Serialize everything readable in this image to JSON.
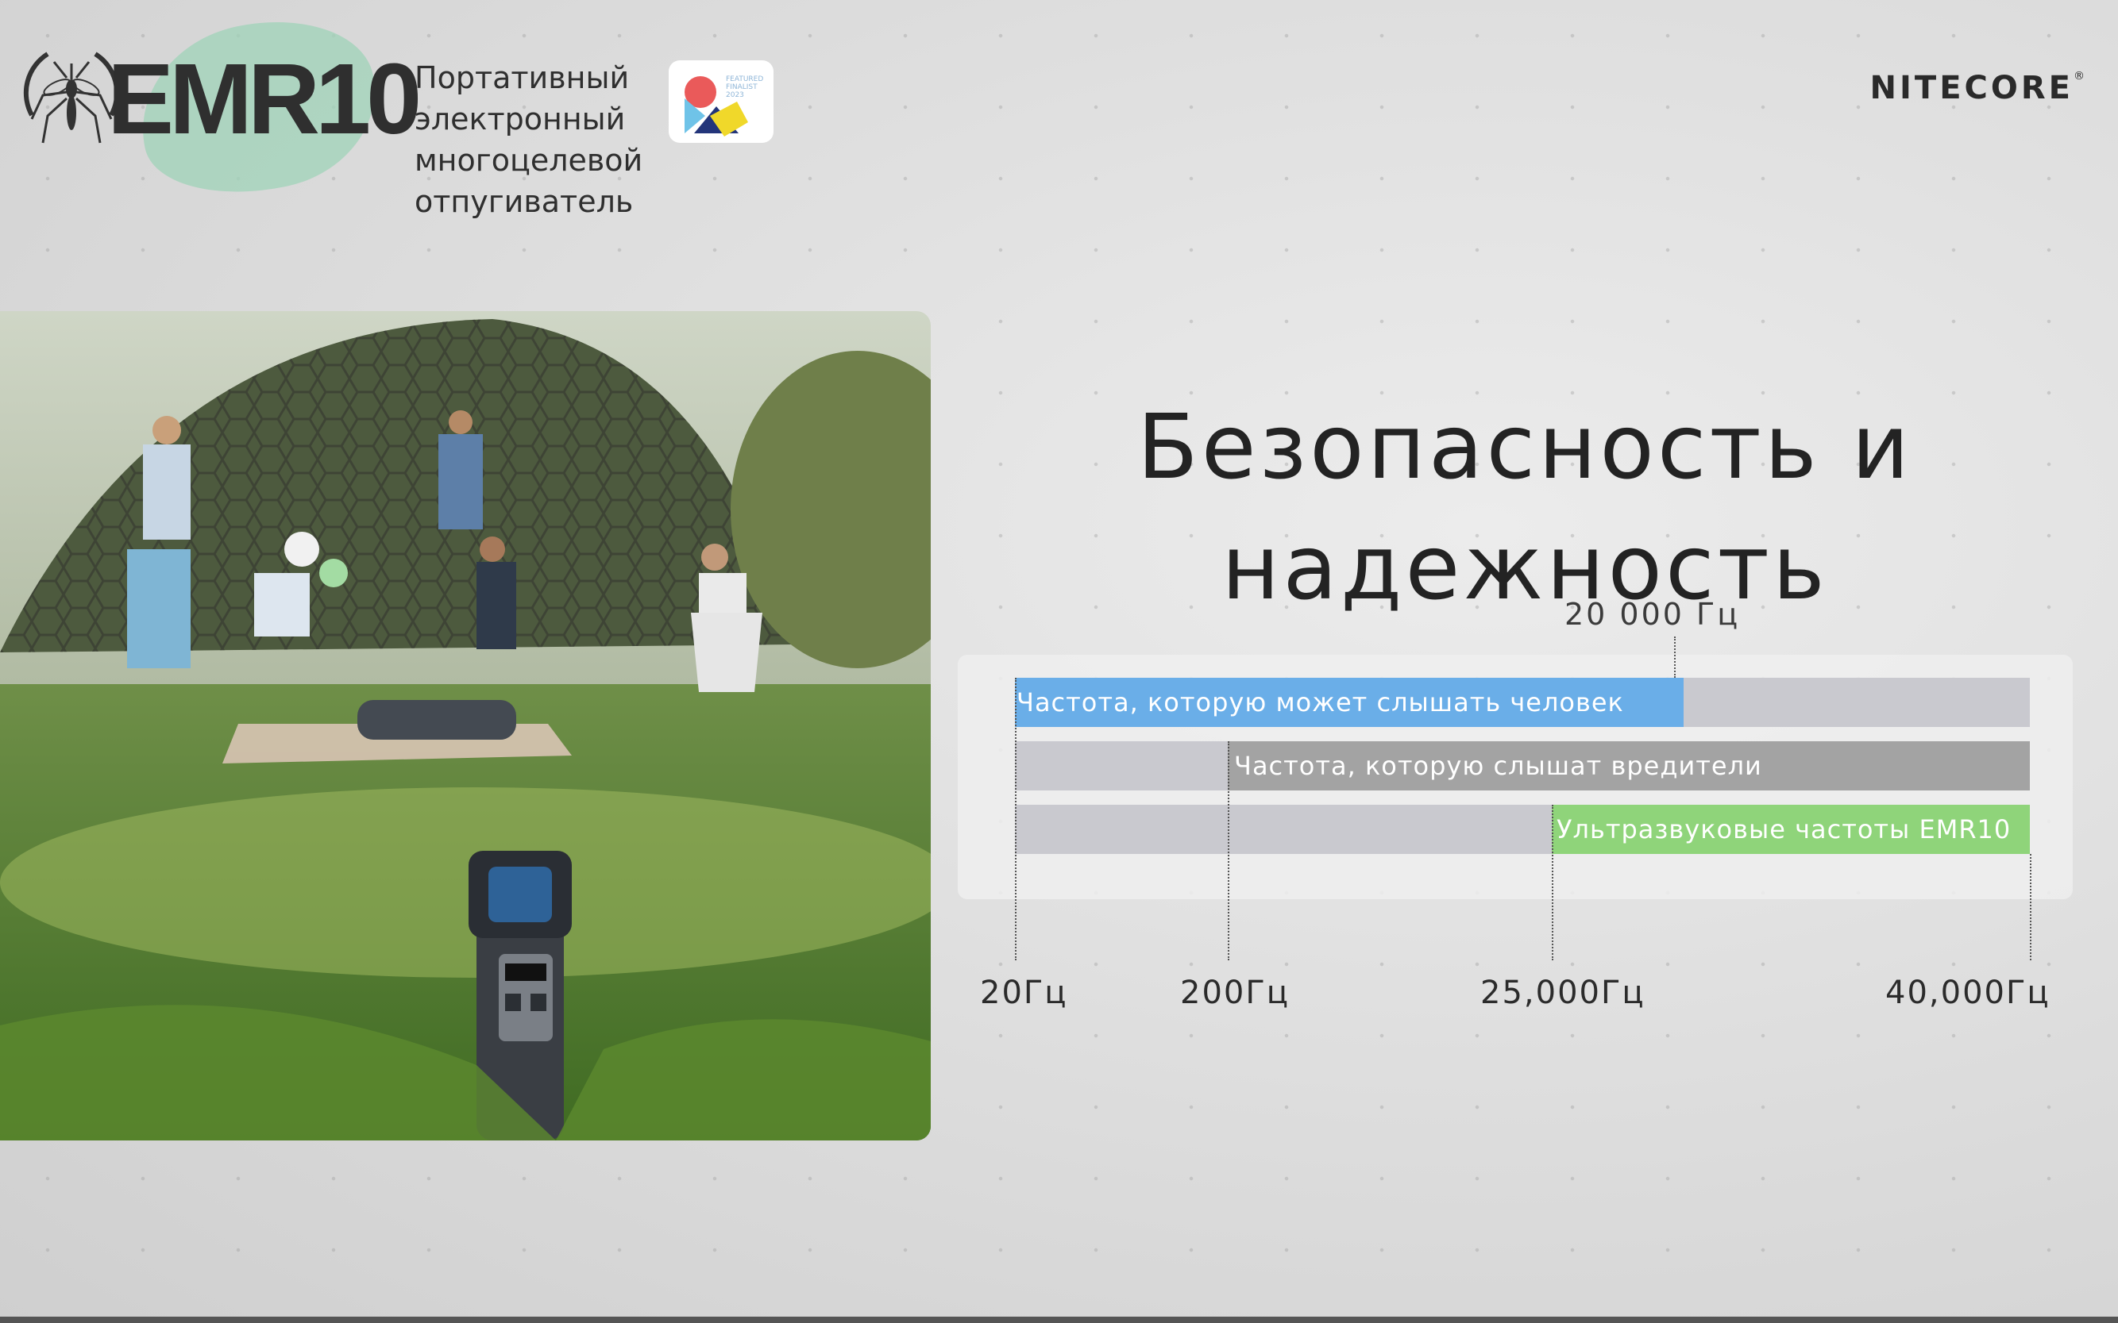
{
  "header": {
    "product_name": "EMR10",
    "tagline_lines": [
      "Портативный",
      "электронный",
      "многоцелевой",
      "отпугиватель"
    ],
    "award_text": [
      "FEATURED",
      "FINALIST",
      "2023"
    ],
    "company": "NITECORE",
    "company_mark": "®"
  },
  "heading": {
    "line1": "Безопасность и",
    "line2": "надежность"
  },
  "chart": {
    "marker_label": "20 000 Гц",
    "bars": [
      {
        "label": "Частота, которую может слышать человек",
        "color": "#6aaee8"
      },
      {
        "label": "Частота, которую слышат вредители",
        "color": "#a3a3a3"
      },
      {
        "label": "Ультразвуковые частоты EMR10",
        "color": "#8fd47a"
      }
    ],
    "ticks": [
      "20Гц",
      "200Гц",
      "25,000Гц",
      "40,000Гц"
    ]
  },
  "colors": {
    "human": "#6aaee8",
    "pests": "#a3a3a3",
    "ultrasonic": "#8fd47a",
    "track": "#c9c9cf"
  }
}
